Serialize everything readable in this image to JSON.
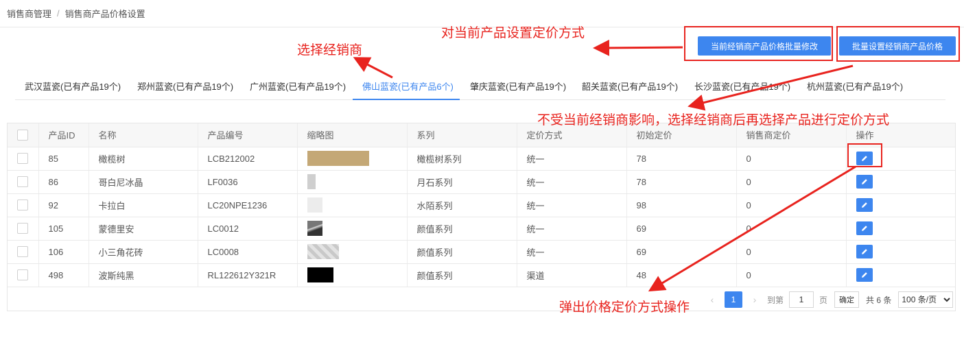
{
  "breadcrumb": {
    "root": "销售商管理",
    "separator": "/",
    "current": "销售商产品价格设置"
  },
  "buttons": {
    "batch_edit": "当前经销商产品价格批量修改",
    "batch_set": "批量设置经销商产品价格"
  },
  "tabs": [
    {
      "label": "武汉蓝瓷(已有产品19个)",
      "active": false
    },
    {
      "label": "郑州蓝瓷(已有产品19个)",
      "active": false
    },
    {
      "label": "广州蓝瓷(已有产品19个)",
      "active": false
    },
    {
      "label": "佛山蓝瓷(已有产品6个)",
      "active": true
    },
    {
      "label": "肇庆蓝瓷(已有产品19个)",
      "active": false
    },
    {
      "label": "韶关蓝瓷(已有产品19个)",
      "active": false
    },
    {
      "label": "长沙蓝瓷(已有产品19个)",
      "active": false
    },
    {
      "label": "杭州蓝瓷(已有产品19个)",
      "active": false
    }
  ],
  "table": {
    "headers": [
      "产品ID",
      "名称",
      "产品编号",
      "缩略图",
      "系列",
      "定价方式",
      "初始定价",
      "销售商定价",
      "操作"
    ],
    "rows": [
      {
        "id": "85",
        "name": "橄榄树",
        "code": "LCB212002",
        "series": "橄榄树系列",
        "pricing": "统一",
        "initial": "78",
        "dealer": "0",
        "thumb_color": "#c4a876"
      },
      {
        "id": "86",
        "name": "哥白尼冰晶",
        "code": "LF0036",
        "series": "月石系列",
        "pricing": "统一",
        "initial": "78",
        "dealer": "0",
        "thumb_color": "#cfcfcf"
      },
      {
        "id": "92",
        "name": "卡拉白",
        "code": "LC20NPE1236",
        "series": "水陌系列",
        "pricing": "统一",
        "initial": "98",
        "dealer": "0",
        "thumb_color": "#ececec"
      },
      {
        "id": "105",
        "name": "蒙德里安",
        "code": "LC0012",
        "series": "颜值系列",
        "pricing": "统一",
        "initial": "69",
        "dealer": "0",
        "thumb_color": "#5a5a5a"
      },
      {
        "id": "106",
        "name": "小三角花砖",
        "code": "LC0008",
        "series": "颜值系列",
        "pricing": "统一",
        "initial": "69",
        "dealer": "0",
        "thumb_color": "#c9c9c9"
      },
      {
        "id": "498",
        "name": "波斯纯黑",
        "code": "RL122612Y321R",
        "series": "颜值系列",
        "pricing": "渠道",
        "initial": "48",
        "dealer": "0",
        "thumb_color": "#000000"
      }
    ]
  },
  "pagination": {
    "prev": "‹",
    "current_page": "1",
    "next": "›",
    "goto_label": "到第",
    "goto_value": "1",
    "page_unit": "页",
    "confirm": "确定",
    "total": "共 6 条",
    "page_size": "100 条/页"
  },
  "annotations": {
    "set_pricing": "对当前产品设置定价方式",
    "choose_dealer": "选择经销商",
    "independent": "不受当前经销商影响，选择经销商后再选择产品进行定价方式",
    "popup": "弹出价格定价方式操作"
  },
  "colors": {
    "primary": "#3d86ef",
    "annotation": "#e8231e"
  }
}
